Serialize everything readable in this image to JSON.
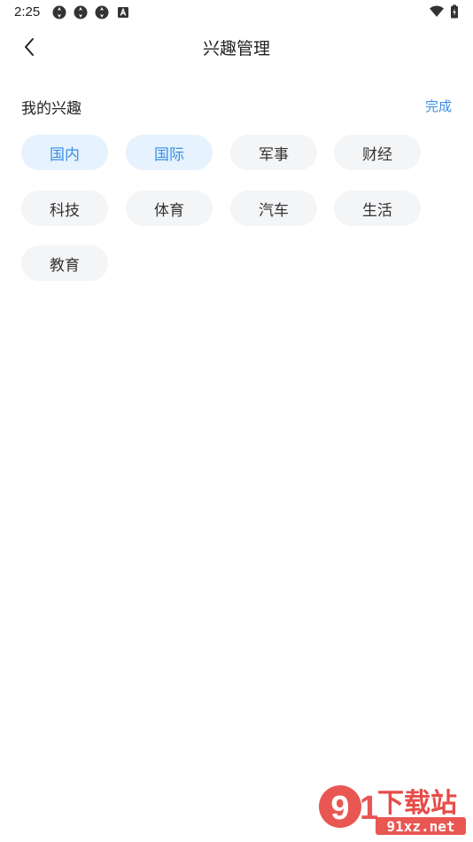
{
  "status_bar": {
    "time": "2:25",
    "left_icons": [
      "notification-icon",
      "notification-icon",
      "notification-icon",
      "app-icon"
    ],
    "right_icons": [
      "wifi-icon",
      "battery-icon"
    ]
  },
  "nav": {
    "title": "兴趣管理",
    "back_icon": "chevron-left-icon"
  },
  "section": {
    "title": "我的兴趣",
    "done_label": "完成"
  },
  "tags": [
    {
      "label": "国内",
      "selected": true
    },
    {
      "label": "国际",
      "selected": true
    },
    {
      "label": "军事",
      "selected": false
    },
    {
      "label": "财经",
      "selected": false
    },
    {
      "label": "科技",
      "selected": false
    },
    {
      "label": "体育",
      "selected": false
    },
    {
      "label": "汽车",
      "selected": false
    },
    {
      "label": "生活",
      "selected": false
    },
    {
      "label": "教育",
      "selected": false
    }
  ],
  "watermark": {
    "logo_text": "下载站",
    "url_text": "91xz.net"
  },
  "colors": {
    "accent": "#3a8ee6",
    "tag_selected_bg": "#e6f2fd",
    "tag_bg": "#f4f5f7",
    "watermark_red": "#e53935"
  }
}
